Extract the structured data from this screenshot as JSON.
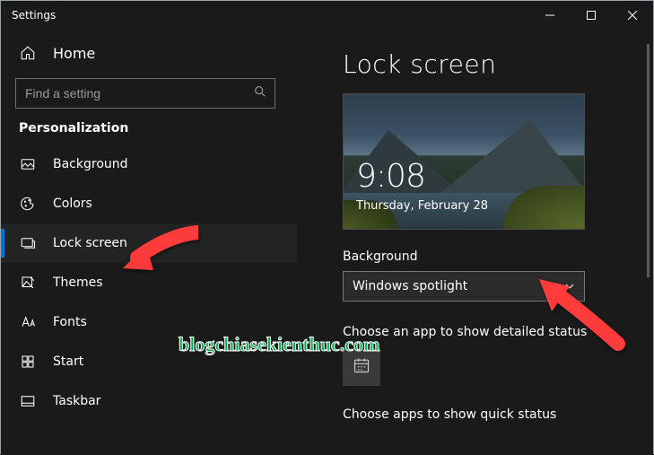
{
  "window": {
    "title": "Settings"
  },
  "sidebar": {
    "home": "Home",
    "search_placeholder": "Find a setting",
    "category": "Personalization",
    "items": [
      {
        "label": "Background",
        "icon": "image-icon",
        "selected": false
      },
      {
        "label": "Colors",
        "icon": "palette-icon",
        "selected": false
      },
      {
        "label": "Lock screen",
        "icon": "lockscreen-icon",
        "selected": true
      },
      {
        "label": "Themes",
        "icon": "themes-icon",
        "selected": false
      },
      {
        "label": "Fonts",
        "icon": "fonts-icon",
        "selected": false
      },
      {
        "label": "Start",
        "icon": "start-icon",
        "selected": false
      },
      {
        "label": "Taskbar",
        "icon": "taskbar-icon",
        "selected": false
      }
    ]
  },
  "main": {
    "title": "Lock screen",
    "preview": {
      "time": "9:08",
      "date": "Thursday, February 28"
    },
    "background_label": "Background",
    "background_value": "Windows spotlight",
    "detailed_label": "Choose an app to show detailed status",
    "quick_label": "Choose apps to show quick status"
  },
  "watermark": "blogchiasekienthuc.com"
}
